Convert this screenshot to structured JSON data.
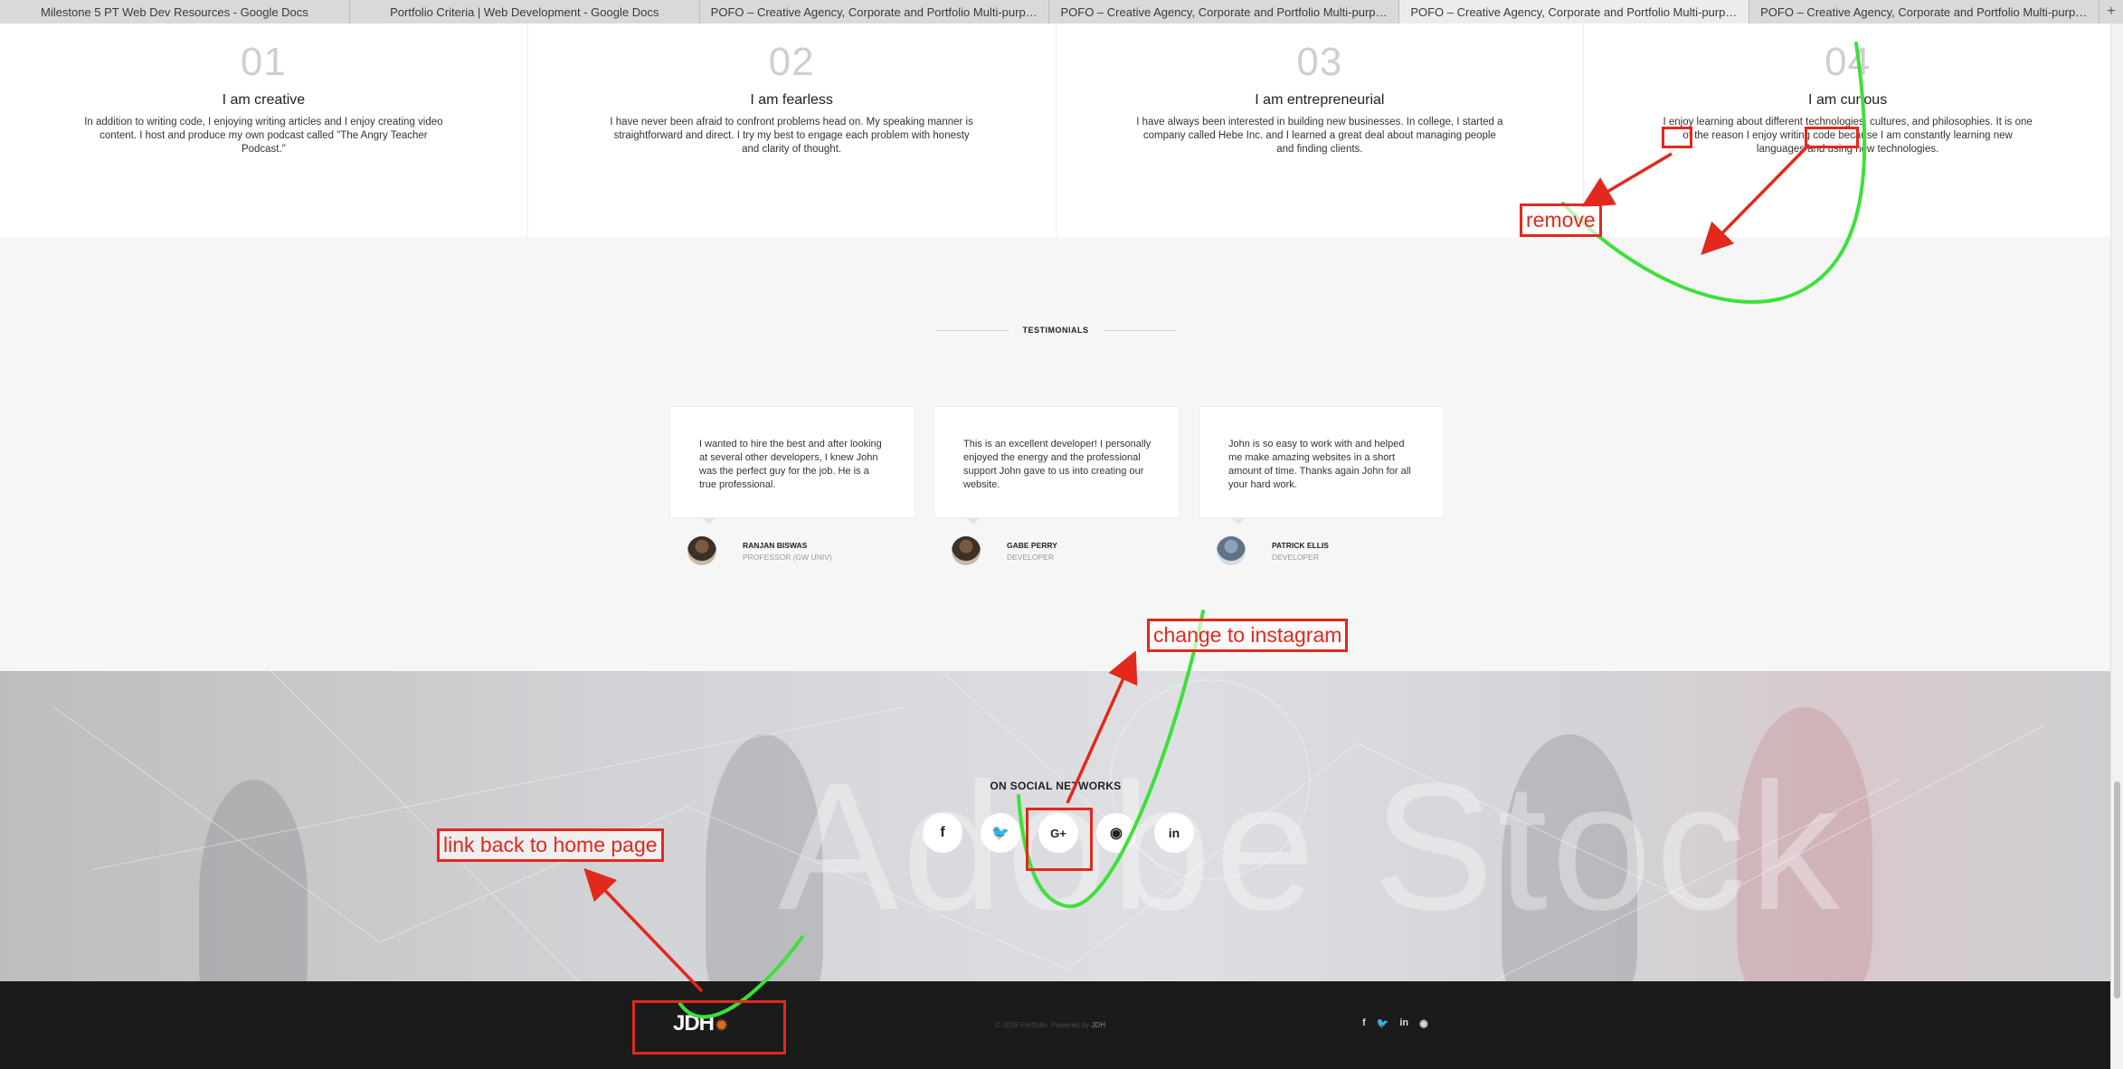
{
  "tabs": [
    "Milestone 5 PT Web Dev Resources - Google Docs",
    "Portfolio Criteria | Web Development - Google Docs",
    "POFO – Creative Agency, Corporate and Portfolio Multi-purpose...",
    "POFO – Creative Agency, Corporate and Portfolio Multi-purpose...",
    "POFO – Creative Agency, Corporate and Portfolio Multi-purpose...",
    "POFO – Creative Agency, Corporate and Portfolio Multi-purpose..."
  ],
  "new_tab": "+",
  "features": [
    {
      "num": "01",
      "title": "I am creative",
      "text": "In addition to writing code, I enjoying writing articles and I enjoy creating video content. I host and produce my own podcast called \"The Angry Teacher Podcast.\""
    },
    {
      "num": "02",
      "title": "I am fearless",
      "text": "I have never been afraid to confront problems head on. My speaking manner is straightforward and direct. I try my best to engage each problem with honesty and clarity of thought."
    },
    {
      "num": "03",
      "title": "I am entrepreneurial",
      "text": "I have always been interested in building new businesses. In college, I started a company called Hebe Inc. and I learned a great deal about managing people and finding clients."
    },
    {
      "num": "04",
      "title": "I am curious",
      "text": "I enjoy learning about different technologies, cultures, and philosophies. It is one of the reason I enjoy writing code because I am constantly learning new languages and using new technologies."
    }
  ],
  "testimonials": {
    "heading": "TESTIMONIALS",
    "items": [
      {
        "quote": "I wanted to hire the best and after looking at several other developers, I knew John was the perfect guy for the job. He is a true professional.",
        "name": "RANJAN BISWAS",
        "role": "PROFESSOR (GW UNIV)"
      },
      {
        "quote": "This is an excellent developer! I personally enjoyed the energy and the professional support John gave to us into creating our website.",
        "name": "GABE PERRY",
        "role": "DEVELOPER"
      },
      {
        "quote": "John is so easy to work with and helped me make amazing websites in a short amount of time. Thanks again John for all your hard work.",
        "name": "PATRICK ELLIS",
        "role": "DEVELOPER"
      }
    ]
  },
  "social": {
    "title": "ON SOCIAL NETWORKS",
    "watermark": "Adobe Stock",
    "icons": [
      {
        "name": "facebook-icon",
        "glyph": "f"
      },
      {
        "name": "twitter-icon",
        "glyph": "🐦"
      },
      {
        "name": "google-plus-icon",
        "glyph": "G+"
      },
      {
        "name": "github-icon",
        "glyph": "◉"
      },
      {
        "name": "linkedin-icon",
        "glyph": "in"
      }
    ]
  },
  "footer": {
    "logo": "JDH",
    "logo_mark": "✹",
    "copyright_prefix": "© 2019 Portfolio. Powered by",
    "copyright_link": "JDH",
    "social": [
      "f",
      "🐦",
      "in",
      "◉"
    ]
  },
  "annotations": {
    "remove": "remove",
    "instagram": "change to instagram",
    "home": "link back to home page"
  },
  "colors": {
    "annotation_red": "#e3281c",
    "annotation_green": "#3ee03a",
    "footer_bg": "#1b1b1b",
    "logo_accent": "#e06b1c"
  }
}
